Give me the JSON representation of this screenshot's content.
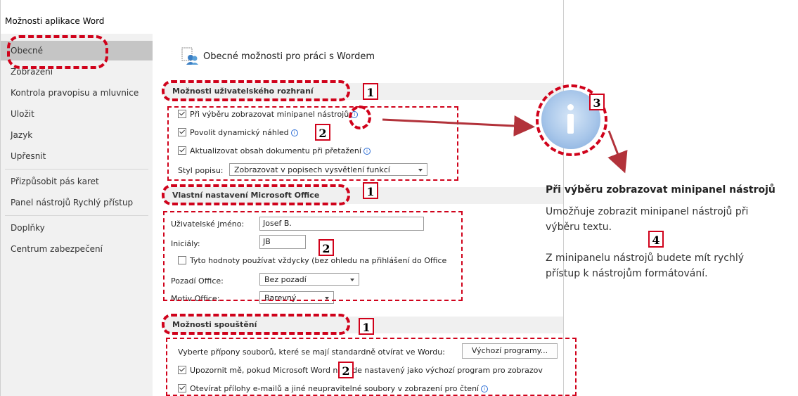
{
  "window": {
    "title": "Možnosti aplikace Word"
  },
  "sidebar": {
    "items": [
      {
        "label": "Obecné",
        "selected": true
      },
      {
        "label": "Zobrazení"
      },
      {
        "label": "Kontrola pravopisu a mluvnice"
      },
      {
        "label": "Uložit"
      },
      {
        "label": "Jazyk"
      },
      {
        "label": "Upřesnit"
      },
      {
        "label": "Přizpůsobit pás karet"
      },
      {
        "label": "Panel nástrojů Rychlý přístup"
      },
      {
        "label": "Doplňky"
      },
      {
        "label": "Centrum zabezpečení"
      }
    ]
  },
  "main": {
    "page_title": "Obecné možnosti pro práci s Wordem",
    "ui_section": {
      "heading": "Možnosti uživatelského rozhraní",
      "minitoolbar": {
        "label": "Při výběru zobrazovat minipanel nástrojů",
        "checked": true
      },
      "live_preview": {
        "label": "Povolit dynamický náhled",
        "checked": true
      },
      "update_drag": {
        "label": "Aktualizovat obsah dokumentu při přetažení",
        "checked": true
      },
      "screentip_label": "Styl popisu:",
      "screentip_value": "Zobrazovat v popisech vysvětlení funkcí"
    },
    "office_section": {
      "heading": "Vlastní nastavení Microsoft Office",
      "username_label": "Uživatelské jméno:",
      "username_value": "Josef B.",
      "initials_label": "Iniciály:",
      "initials_value": "JB",
      "always_use": {
        "label": "Tyto hodnoty používat vždycky (bez ohledu na přihlášení do Office",
        "checked": false
      },
      "background_label": "Pozadí Office:",
      "background_value": "Bez pozadí",
      "theme_label": "Motiv Office:",
      "theme_value": "Barevný"
    },
    "startup_section": {
      "heading": "Možnosti spouštění",
      "extensions_text": "Vyberte přípony souborů, které se mají standardně otvírat ve Wordu:",
      "default_programs_button": "Výchozí programy...",
      "notify_default": {
        "label": "Upozornit mě, pokud Microsoft Word nebude nastavený jako výchozí program pro zobrazov",
        "checked": true
      },
      "open_attachments": {
        "label": "Otevírat přílohy e-mailů a jiné neupravitelné soubory v zobrazení pro čtení",
        "checked": true
      }
    }
  },
  "tooltip": {
    "title": "Při výběru zobrazovat minipanel nástrojů",
    "line1": "Umožňuje zobrazit minipanel nástrojů při",
    "line2": "výběru textu.",
    "line3": "Z minipanelu nástrojů budete mít rychlý",
    "line4": "přístup k nástrojům formátování."
  },
  "annotations": {
    "badges": [
      "1",
      "2",
      "3",
      "4"
    ]
  },
  "colors": {
    "annotation_red": "#d0021b",
    "info_blue": "#2f6fd6",
    "selected_gray": "#c5c5c5"
  }
}
